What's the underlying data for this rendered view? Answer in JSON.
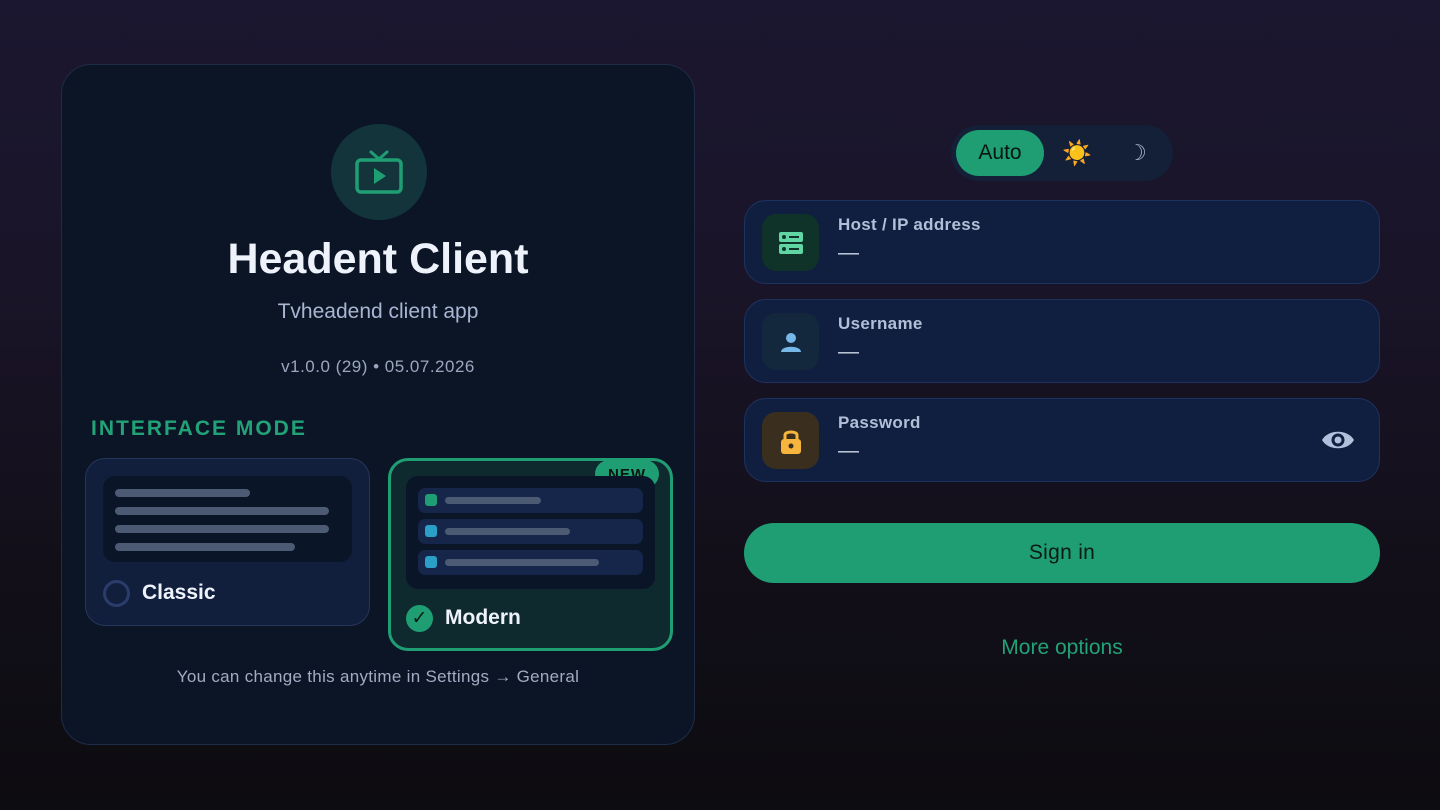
{
  "colors": {
    "accent": "#1f9e74",
    "background": "#1a1428",
    "card": "#0c1526",
    "field": "#101f40",
    "warning": "#f6b53c"
  },
  "app": {
    "icon": "tv-play-icon",
    "title": "Headent Client",
    "subtitle": "Tvheadend client app",
    "version": "v1.0.0 (29) • 05.07.2026"
  },
  "interface_mode": {
    "heading": "INTERFACE MODE",
    "options": [
      {
        "label": "Classic",
        "selected": false
      },
      {
        "label": "Modern",
        "selected": true,
        "badge": "NEW",
        "check": "✓"
      }
    ],
    "hint": "You can change this anytime in Settings → General"
  },
  "theme": {
    "options": [
      {
        "label": "Auto",
        "selected": true
      },
      {
        "icon": "sun-icon",
        "glyph": "☀️",
        "selected": false
      },
      {
        "icon": "moon-icon",
        "glyph": "☽",
        "selected": false
      }
    ]
  },
  "form": {
    "host": {
      "label": "Host / IP address",
      "value": "—",
      "icon": "server-icon"
    },
    "username": {
      "label": "Username",
      "value": "—",
      "icon": "person-icon"
    },
    "password": {
      "label": "Password",
      "value": "—",
      "icon": "lock-icon",
      "toggle_icon": "eye-icon"
    },
    "sign_in_label": "Sign in",
    "more_options_label": "More options"
  }
}
